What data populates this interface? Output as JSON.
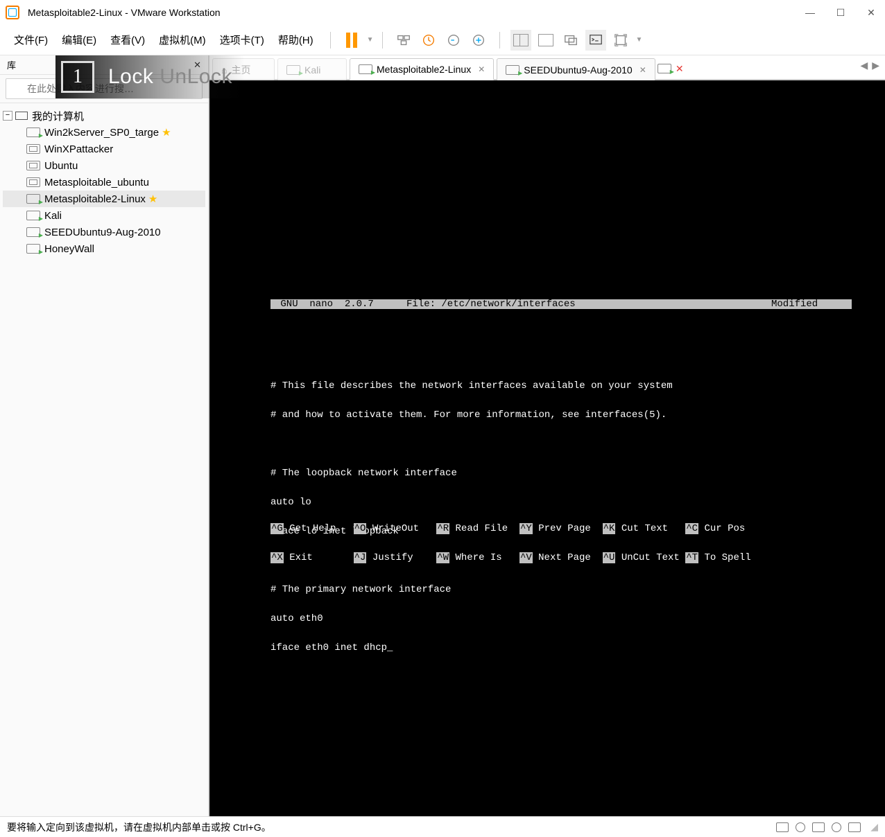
{
  "titlebar": {
    "title": "Metasploitable2-Linux - VMware Workstation"
  },
  "menu": {
    "file": "文件(F)",
    "edit": "编辑(E)",
    "view": "查看(V)",
    "vm": "虚拟机(M)",
    "tabs": "选项卡(T)",
    "help": "帮助(H)"
  },
  "sidebar": {
    "title": "库",
    "search_placeholder": "在此处键入内容进行搜…",
    "root": "我的计算机",
    "items": [
      {
        "label": "Win2kServer_SP0_targe",
        "running": true,
        "star": true
      },
      {
        "label": "WinXPattacker",
        "running": false,
        "star": false
      },
      {
        "label": "Ubuntu",
        "running": false,
        "star": false
      },
      {
        "label": "Metasploitable_ubuntu",
        "running": false,
        "star": false
      },
      {
        "label": "Metasploitable2-Linux",
        "running": true,
        "star": true,
        "selected": true
      },
      {
        "label": "Kali",
        "running": true,
        "star": false
      },
      {
        "label": "SEEDUbuntu9-Aug-2010",
        "running": true,
        "star": false
      },
      {
        "label": "HoneyWall",
        "running": true,
        "star": false
      }
    ]
  },
  "tabs": {
    "home": "主页",
    "kali": "Kali",
    "active": "Metasploitable2-Linux",
    "seed": "SEEDUbuntu9-Aug-2010"
  },
  "overlay": {
    "key": "1",
    "label_on": "Lock",
    "label_off": "UnLock"
  },
  "nano": {
    "version": " GNU  nano  2.0.7",
    "file_label": "File: /etc/network/interfaces",
    "modified": "Modified ",
    "lines": [
      "# This file describes the network interfaces available on your system",
      "# and how to activate them. For more information, see interfaces(5).",
      "",
      "# The loopback network interface",
      "auto lo",
      "iface lo inet loopback",
      "",
      "# The primary network interface",
      "auto eth0",
      "iface eth0 inet dhcp_"
    ],
    "footer": {
      "G": "Get Help",
      "O": "WriteOut",
      "R": "Read File",
      "Y": "Prev Page",
      "K": "Cut Text",
      "C": "Cur Pos",
      "X": "Exit",
      "J": "Justify",
      "W": "Where Is",
      "V": "Next Page",
      "U": "UnCut Text",
      "T": "To Spell"
    }
  },
  "statusbar": {
    "text": "要将输入定向到该虚拟机，请在虚拟机内部单击或按 Ctrl+G。"
  }
}
